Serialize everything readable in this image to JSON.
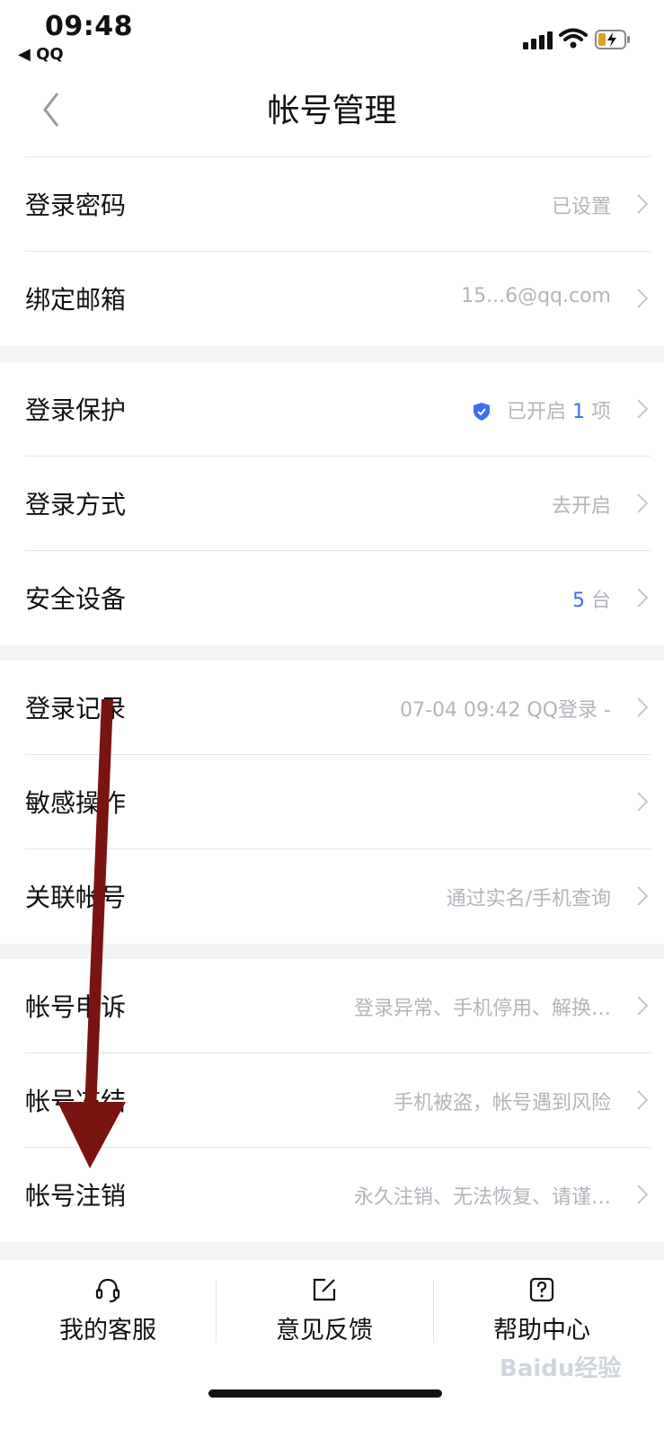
{
  "status_bar": {
    "time": "09:48",
    "back_app": "◀ QQ"
  },
  "nav": {
    "title": "帐号管理"
  },
  "rows": [
    {
      "label": "登录密码",
      "value": "已设置"
    },
    {
      "label": "绑定邮箱",
      "value": "15...6@qq.com"
    },
    {
      "label": "登录保护",
      "value_prefix": "已开启 ",
      "value_highlight": "1",
      "value_suffix": " 项"
    },
    {
      "label": "登录方式",
      "value": "去开启"
    },
    {
      "label": "安全设备",
      "value_highlight": "5",
      "value_suffix": " 台"
    },
    {
      "label": "登录记录",
      "value": "07-04 09:42 QQ登录 -"
    },
    {
      "label": "敏感操作",
      "value": ""
    },
    {
      "label": "关联帐号",
      "value": "通过实名/手机查询"
    },
    {
      "label": "帐号申诉",
      "value": "登录异常、手机停用、解换…"
    },
    {
      "label": "帐号冻结",
      "value": "手机被盗，帐号遇到风险"
    },
    {
      "label": "帐号注销",
      "value": "永久注销、无法恢复、请谨…"
    }
  ],
  "bottom_bar": {
    "tabs": [
      {
        "label": "我的客服",
        "icon": "headset-icon"
      },
      {
        "label": "意见反馈",
        "icon": "edit-icon"
      },
      {
        "label": "帮助中心",
        "icon": "help-icon"
      }
    ]
  },
  "watermark": "Baidu经验",
  "colors": {
    "accent": "#3d6ff3",
    "secondary_text": "#b2b5bb",
    "group_gap": "#f2f3f5",
    "arrow": "#7a1410"
  }
}
